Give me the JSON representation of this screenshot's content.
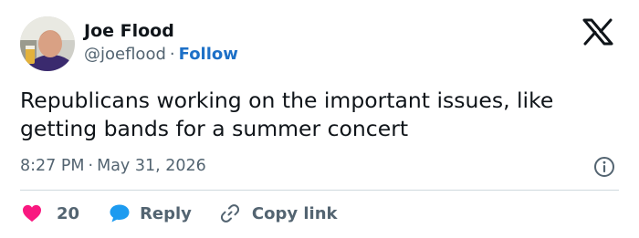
{
  "author": {
    "name": "Joe Flood",
    "handle": "@joeflood",
    "separator": "·",
    "follow_label": "Follow"
  },
  "tweet": {
    "text": "Republicans working on the important issues, like getting bands for a summer concert",
    "time": "8:27 PM",
    "separator": "·",
    "date": "May 31, 2026"
  },
  "actions": {
    "like_count": "20",
    "reply_label": "Reply",
    "copy_link_label": "Copy link"
  },
  "icons": {
    "logo": "x-logo-icon",
    "info": "info-icon",
    "like": "heart-icon",
    "reply": "speech-bubble-icon",
    "copy": "link-icon"
  },
  "colors": {
    "heart": "#f91880",
    "reply": "#1d9bf0",
    "follow": "#1d70c7",
    "secondary_text": "#536471",
    "divider": "#cfd9de"
  }
}
